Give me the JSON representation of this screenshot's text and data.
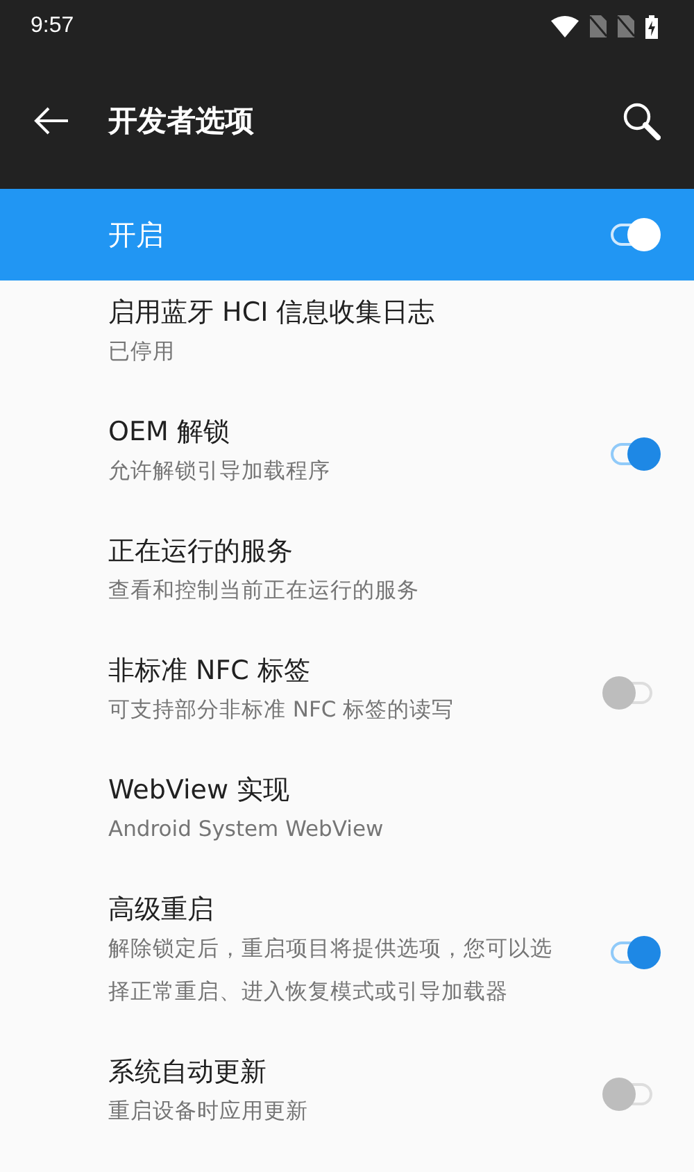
{
  "status_bar": {
    "time": "9:57"
  },
  "toolbar": {
    "title": "开发者选项"
  },
  "master_switch": {
    "label": "开启",
    "on": true
  },
  "settings": [
    {
      "title": "启用蓝牙 HCI 信息收集日志",
      "subtitle": "已停用",
      "kind": "plain"
    },
    {
      "title": "OEM 解锁",
      "subtitle": "允许解锁引导加载程序",
      "kind": "toggle",
      "on": true
    },
    {
      "title": "正在运行的服务",
      "subtitle": "查看和控制当前正在运行的服务",
      "kind": "plain"
    },
    {
      "title": "非标准 NFC 标签",
      "subtitle": "可支持部分非标准 NFC 标签的读写",
      "kind": "toggle",
      "on": false
    },
    {
      "title": "WebView 实现",
      "subtitle": "Android System WebView",
      "kind": "plain"
    },
    {
      "title": "高级重启",
      "subtitle": "解除锁定后，重启项目将提供选项，您可以选择正常重启、进入恢复模式或引导加载器",
      "kind": "toggle",
      "on": true
    },
    {
      "title": "系统自动更新",
      "subtitle": "重启设备时应用更新",
      "kind": "toggle",
      "on": false
    }
  ]
}
